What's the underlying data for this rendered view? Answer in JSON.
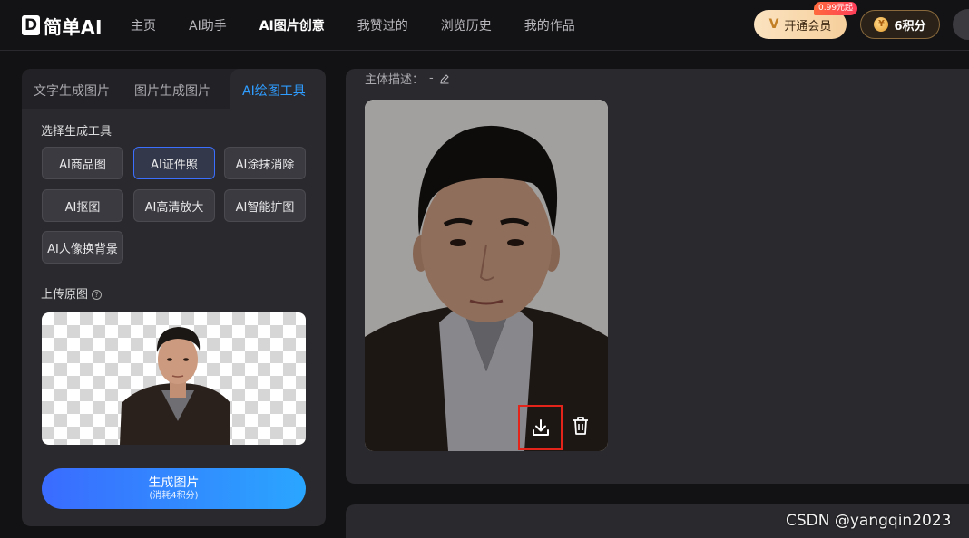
{
  "header": {
    "logo_mark": "D",
    "logo_text": "简单AI",
    "nav": [
      "主页",
      "AI助手",
      "AI图片创意",
      "我赞过的",
      "浏览历史",
      "我的作品"
    ],
    "active_nav": "AI图片创意",
    "vip_label": "开通会员",
    "vip_icon": "V",
    "vip_tag": "0.99元起",
    "points_label": "6积分",
    "points_icon": "coin-icon"
  },
  "left_panel": {
    "tabs": [
      "文字生成图片",
      "图片生成图片",
      "AI绘图工具"
    ],
    "active_tab": "AI绘图工具",
    "tool_section_title": "选择生成工具",
    "tools": [
      "AI商品图",
      "AI证件照",
      "AI涂抹消除",
      "AI抠图",
      "AI高清放大",
      "AI智能扩图",
      "AI人像换背景"
    ],
    "selected_tool": "AI证件照",
    "upload_title": "上传原图",
    "help_icon": "?",
    "generate_label": "生成图片",
    "generate_sub": "(消耗4积分)"
  },
  "result": {
    "desc_label": "主体描述：",
    "desc_value": "-",
    "download_icon": "download-icon",
    "delete_icon": "trash-icon"
  },
  "watermark": "CSDN @yangqin2023",
  "colors": {
    "accent": "#2f9cff",
    "highlight_border": "#e3241b",
    "vip_gold": "#f6cf9c"
  }
}
